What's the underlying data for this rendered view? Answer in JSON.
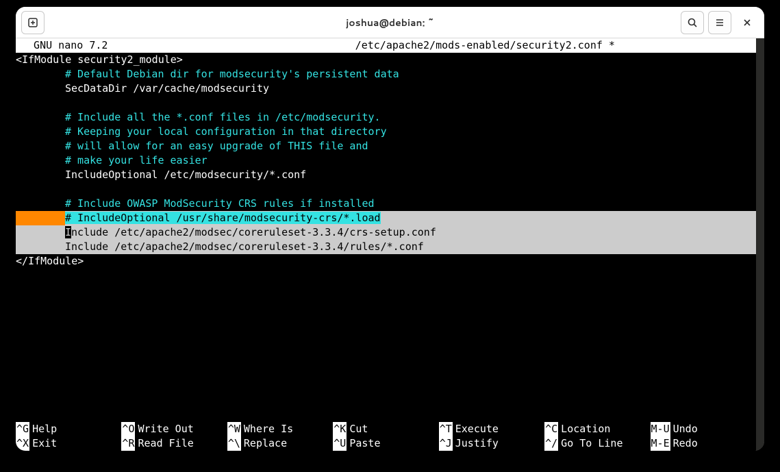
{
  "window": {
    "title": "joshua@debian: ~"
  },
  "nano": {
    "app": "  GNU nano 7.2",
    "file": "/etc/apache2/mods-enabled/security2.conf *"
  },
  "code": {
    "l1": "<IfModule security2_module>",
    "l2": "# Default Debian dir for modsecurity's persistent data",
    "l3": "SecDataDir /var/cache/modsecurity",
    "l4": "# Include all the *.conf files in /etc/modsecurity.",
    "l5": "# Keeping your local configuration in that directory",
    "l6": "# will allow for an easy upgrade of THIS file and",
    "l7": "# make your life easier",
    "l8": "IncludeOptional /etc/modsecurity/*.conf",
    "l9": "# Include OWASP ModSecurity CRS rules if installed",
    "l10": "# IncludeOptional /usr/share/modsecurity-crs/*.load",
    "l11a": "I",
    "l11b": "nclude /etc/apache2/modsec/coreruleset-3.3.4/crs-setup.conf",
    "l12": "Include /etc/apache2/modsec/coreruleset-3.3.4/rules/*.conf",
    "l13": "</IfModule>"
  },
  "shortcuts": {
    "r1": [
      {
        "k": "^G",
        "l": "Help"
      },
      {
        "k": "^O",
        "l": "Write Out"
      },
      {
        "k": "^W",
        "l": "Where Is"
      },
      {
        "k": "^K",
        "l": "Cut"
      },
      {
        "k": "^T",
        "l": "Execute"
      },
      {
        "k": "^C",
        "l": "Location"
      },
      {
        "k": "M-U",
        "l": "Undo"
      }
    ],
    "r2": [
      {
        "k": "^X",
        "l": "Exit"
      },
      {
        "k": "^R",
        "l": "Read File"
      },
      {
        "k": "^\\",
        "l": "Replace"
      },
      {
        "k": "^U",
        "l": "Paste"
      },
      {
        "k": "^J",
        "l": "Justify"
      },
      {
        "k": "^/",
        "l": "Go To Line"
      },
      {
        "k": "M-E",
        "l": "Redo"
      }
    ]
  }
}
